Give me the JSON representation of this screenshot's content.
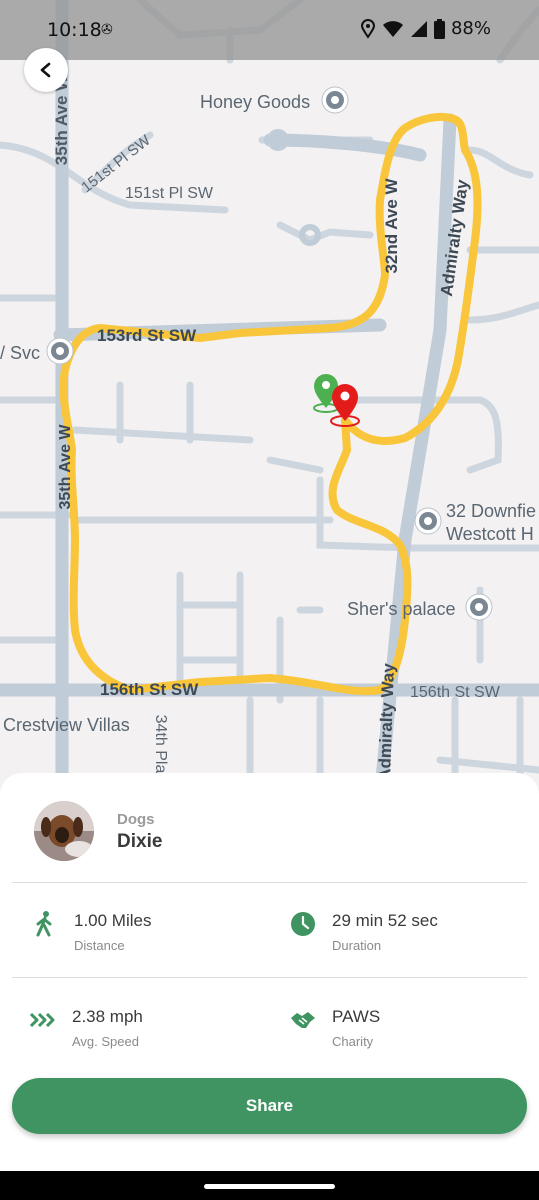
{
  "status_bar": {
    "time": "10:18",
    "battery": "88%"
  },
  "map": {
    "street_labels": {
      "35th_ave_top": "35th Ave W",
      "151st_pl_diag": "151st Pl SW",
      "151st_pl": "151st Pl SW",
      "153rd_st": "153rd St SW",
      "32nd_ave": "32nd Ave W",
      "admiralty_top": "Admiralty Way",
      "35th_ave_mid": "35th Ave W",
      "156th_st_left": "156th St SW",
      "156th_st_right": "156th St SW",
      "admiralty_bottom": "Admiralty Way",
      "34th_pl": "34th Pla"
    },
    "pois": {
      "honey_goods": "Honey Goods",
      "svc": "/ Svc",
      "downfield_1": "32 Downfie",
      "downfield_2": "Westcott H",
      "shers_palace": "Sher's palace",
      "crestview": "Crestview Villas"
    },
    "colors": {
      "route": "#f9c53a",
      "start_pin": "#4caf50",
      "end_pin": "#e31b1b"
    }
  },
  "summary": {
    "dog_category": "Dogs",
    "dog_name": "Dixie",
    "distance_value": "1.00 Miles",
    "distance_label": "Distance",
    "duration_value": "29 min 52 sec",
    "duration_label": "Duration",
    "speed_value": "2.38 mph",
    "speed_label": "Avg. Speed",
    "charity_value": "PAWS",
    "charity_label": "Charity",
    "share_label": "Share",
    "accent_color": "#3f9462"
  }
}
